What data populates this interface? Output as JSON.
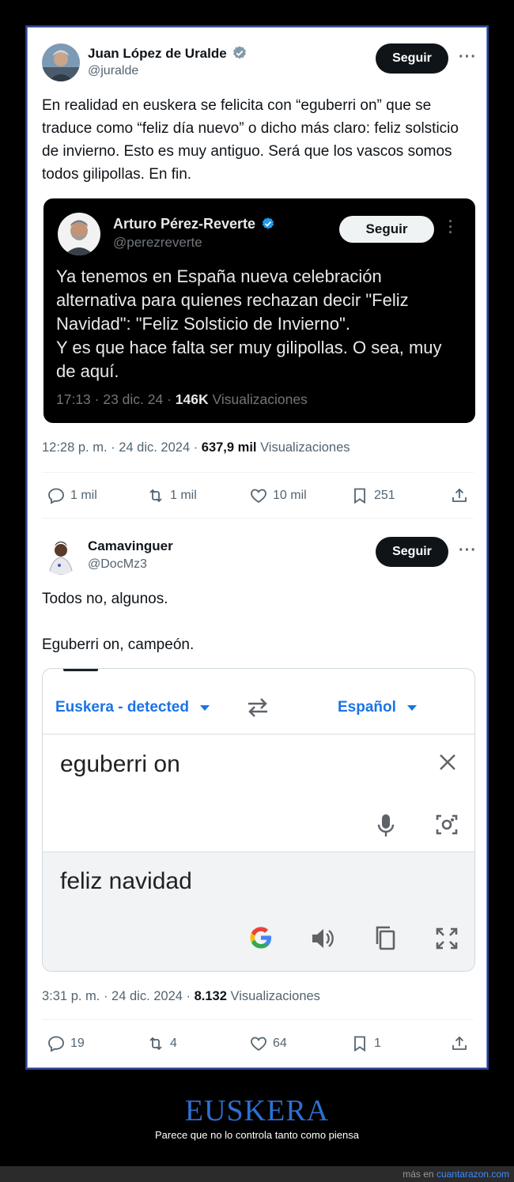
{
  "tweet1": {
    "name": "Juan López de Uralde",
    "handle": "@juralde",
    "follow_label": "Seguir",
    "text": "En realidad en euskera se felicita con “eguberri on” que se traduce como “feliz día nuevo” o dicho más claro: feliz solsticio de invierno. Esto es muy antiguo. Será que los vascos somos todos gilipollas. En fin.",
    "quote": {
      "name": "Arturo Pérez-Reverte",
      "handle": "@perezreverte",
      "follow_label": "Seguir",
      "text_line1": "Ya tenemos en España nueva celebración alternativa para quienes rechazan decir \"Feliz Navidad\": \"Feliz Solsticio de Invierno\".",
      "text_line2": "Y es que hace falta ser muy gilipollas. O sea, muy de aquí.",
      "time": "17:13 · 23 dic. 24 · ",
      "views": "146K",
      "views_label": " Visualizaciones"
    },
    "time": "12:28 p. m. · 24 dic. 2024 · ",
    "views": "637,9 mil",
    "views_label": " Visualizaciones",
    "replies": "1 mil",
    "retweets": "1 mil",
    "likes": "10 mil",
    "bookmarks": "251"
  },
  "tweet2": {
    "name": "Camavinguer",
    "handle": "@DocMz3",
    "follow_label": "Seguir",
    "text_line1": "Todos no, algunos.",
    "text_line2": "Eguberri on, campeón.",
    "translate": {
      "source_lang": "Euskera - detected",
      "target_lang": "Español",
      "source_text": "eguberri on",
      "result_text": "feliz navidad"
    },
    "time": "3:31 p. m. · 24 dic. 2024 · ",
    "views": "8.132",
    "views_label": " Visualizaciones",
    "replies": "19",
    "retweets": "4",
    "likes": "64",
    "bookmarks": "1"
  },
  "footer": {
    "title": "EUSKERA",
    "subtitle": "Parece que no lo controla tanto como piensa",
    "more_prefix": "más en ",
    "site": "cuantarazon.com"
  },
  "colors": {
    "accent_blue": "#1d9bf0",
    "google_blue": "#1a73e8",
    "footer_title": "#2e6fd2"
  }
}
